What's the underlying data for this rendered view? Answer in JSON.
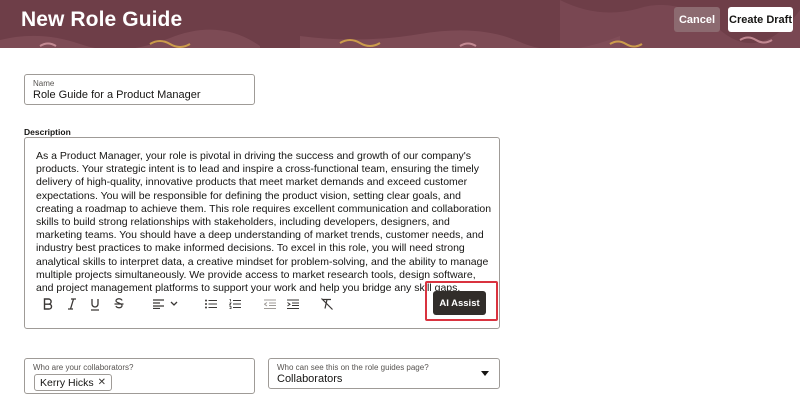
{
  "header": {
    "title": "New Role Guide",
    "cancel_label": "Cancel",
    "create_label": "Create Draft"
  },
  "name_field": {
    "label": "Name",
    "value": "Role Guide for a Product Manager"
  },
  "description": {
    "label": "Description",
    "text": "As a Product Manager, your role is pivotal in driving the success and growth of our company's products. Your strategic intent is to lead and inspire a cross-functional team, ensuring the timely delivery of high-quality, innovative products that meet market demands and exceed customer expectations. You will be responsible for defining the product vision, setting clear goals, and creating a roadmap to achieve them. This role requires excellent communication and collaboration skills to build strong relationships with stakeholders, including developers, designers, and marketing teams. You should have a deep understanding of market trends, customer needs, and industry best practices to make informed decisions. To excel in this role, you will need strong analytical skills to interpret data, a creative mindset for problem-solving, and the ability to manage multiple projects simultaneously. We provide access to market research tools, design software, and project management platforms to support your work and help you bridge any skill gaps.",
    "ai_assist_label": "AI Assist",
    "toolbar_icons": [
      "bold-icon",
      "italic-icon",
      "underline-icon",
      "strikethrough-icon",
      "align-icon",
      "chevron-down-icon",
      "bulleted-list-icon",
      "numbered-list-icon",
      "outdent-icon",
      "indent-icon",
      "clear-format-icon"
    ]
  },
  "collaborators": {
    "label": "Who are your collaborators?",
    "chips": [
      "Kerry Hicks"
    ]
  },
  "visibility": {
    "label": "Who can see this on the role guides page?",
    "value": "Collaborators"
  },
  "colors": {
    "header_bg": "#6e3e48",
    "ai_button_bg": "#312d2a",
    "highlight": "#d9333f"
  }
}
